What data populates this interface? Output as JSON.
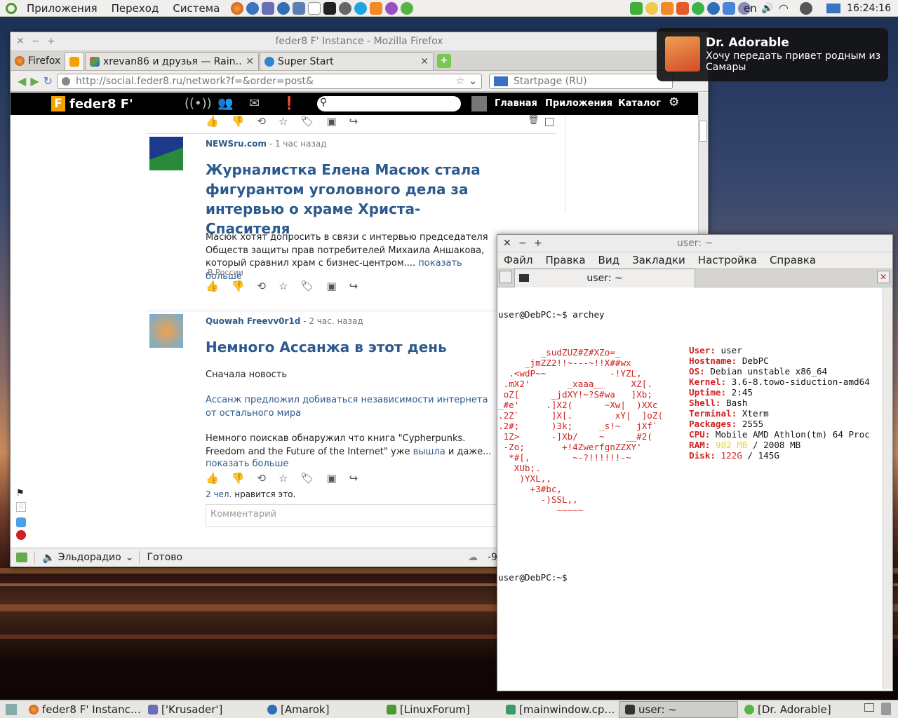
{
  "top_panel": {
    "menus": [
      "Приложения",
      "Переход",
      "Система"
    ],
    "lang": "en",
    "clock": "16:24:16"
  },
  "firefox": {
    "title": "feder8 F' Instance - Mozilla Firefox",
    "app_tab": "Firefox",
    "tabs": [
      "xrevan86 и друзья — Rain…",
      "Super Start"
    ],
    "url": "http://social.feder8.ru/network?f=&order=post&",
    "search_placeholder": "Startpage (RU)",
    "site": {
      "brand": "feder8 F'",
      "nav": [
        "Главная",
        "Приложения",
        "Каталог"
      ]
    },
    "posts": [
      {
        "author": "NEWSru.com",
        "time": "- 1 час назад",
        "title": "Журналистка Елена Масюк стала фигурантом уголовного дела за интервью о храме Христа-Спасителя",
        "body": "Масюк хотят допросить в связи с интервью председателя Обществ защиты прав потребителей Михаила Аншакова, который сравнил храм с бизнес-центром....",
        "more": "показать больше",
        "tag": "В России"
      },
      {
        "author": "Quowah Freevv0r1d",
        "time": "- 2 час. назад",
        "title": "Немного Ассанжа в этот день",
        "intro": "Сначала новость",
        "link": "Ассанж предложил добиваться независимости интернета от остального мира",
        "body1": "Немного поискав обнаружил что книга \"Cypherpunks. Freedom and the Future of the Internet\" уже",
        "body_link": "вышла",
        "body2": "и даже...",
        "more": "показать больше",
        "likes_count": "2 чел.",
        "likes_text": "нравится это.",
        "comment_placeholder": "Комментарий"
      }
    ],
    "status": {
      "radio": "Эльдорадио",
      "text": "Готово",
      "temp": "-9"
    }
  },
  "notification": {
    "title": "Dr. Adorable",
    "text": "Хочу передать привет родным из Самары"
  },
  "terminal": {
    "title": "user: ~",
    "menu": [
      "Файл",
      "Правка",
      "Вид",
      "Закладки",
      "Настройка",
      "Справка"
    ],
    "tab": "user: ~",
    "prompt1": "user@DebPC:~$ archey",
    "prompt2": "user@DebPC:~$",
    "info": [
      {
        "k": "User:",
        "v": " user"
      },
      {
        "k": "Hostname:",
        "v": " DebPC"
      },
      {
        "k": "OS:",
        "v": " Debian unstable x86_64"
      },
      {
        "k": "Kernel:",
        "v": " 3.6-8.towo-siduction-amd64"
      },
      {
        "k": "Uptime:",
        "v": " 2:45"
      },
      {
        "k": "Shell:",
        "v": " Bash"
      },
      {
        "k": "Terminal:",
        "v": " Xterm"
      },
      {
        "k": "Packages:",
        "v": " 2555"
      },
      {
        "k": "CPU:",
        "v": " Mobile AMD Athlon(tm) 64 Proc"
      }
    ],
    "ram_label": "RAM:",
    "ram_used": "982 MB",
    "ram_total": " / 2008 MB",
    "disk_label": "Disk:",
    "disk_used": "122G",
    "disk_total": " / 145G",
    "logo": [
      "        _sudZUZ#Z#XZo=_",
      "     _jmZZ2!!~---~!!X##wx",
      "  .<wdP~~            -!YZL,",
      " .mX2'       _xaaa__     XZ[.",
      " oZ[      _jdXY!~?S#wa   ]Xb;",
      "_#e'     .]X2(      ~Xw|  )XXc",
      ".2Z`      ]X[.        xY|  ]oZ(",
      ".2#;      )3k;     _s!~   jXf`",
      " 1Z>      -]Xb/    ~    __#2(",
      " -Zo;       +!4ZwerfgnZZXY'",
      "  *#[,        ~-?!!!!!!-~",
      "   XUb;.",
      "    )YXL,,",
      "      +3#bc,",
      "        -)SSL,,",
      "           ~~~~~"
    ]
  },
  "taskbar": {
    "tasks": [
      "feder8 F' Instanc…",
      "['Krusader']",
      "[Amarok]",
      "[LinuxForum]",
      "[mainwindow.cp…",
      "user: ~",
      "[Dr. Adorable]"
    ]
  }
}
